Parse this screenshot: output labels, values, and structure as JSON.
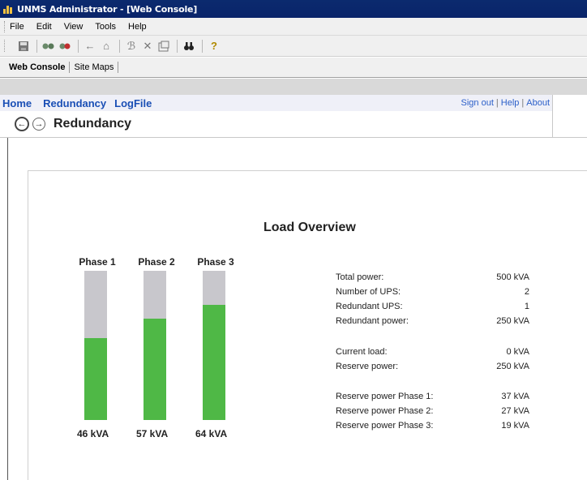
{
  "window": {
    "title": "UNMS Administrator - [Web Console]"
  },
  "menu": [
    "File",
    "Edit",
    "View",
    "Tools",
    "Help"
  ],
  "tabs": [
    {
      "label": "Web Console",
      "active": true
    },
    {
      "label": "Site Maps",
      "active": false
    }
  ],
  "nav": {
    "home": "Home",
    "redundancy": "Redundancy",
    "logfile": "LogFile",
    "sign_out": "Sign out",
    "help": "Help",
    "about": "About",
    "separator": "|"
  },
  "page": {
    "title": "Redundancy",
    "back_icon": "back-arrow-icon",
    "forward_icon": "forward-arrow-icon"
  },
  "load_overview": {
    "title": "Load Overview",
    "phases": [
      {
        "label": "Phase 1",
        "value": "46 kVA",
        "fill_fraction": 0.55
      },
      {
        "label": "Phase 2",
        "value": "57 kVA",
        "fill_fraction": 0.68
      },
      {
        "label": "Phase 3",
        "value": "64 kVA",
        "fill_fraction": 0.77
      }
    ],
    "stats": [
      {
        "label": "Total power:",
        "value": "500 kVA"
      },
      {
        "label": "Number of UPS:",
        "value": "2"
      },
      {
        "label": "Redundant UPS:",
        "value": "1"
      },
      {
        "label": "Redundant power:",
        "value": "250 kVA"
      },
      {
        "label": "Current load:",
        "value": "0 kVA"
      },
      {
        "label": "Reserve power:",
        "value": "250 kVA"
      },
      {
        "label": "Reserve power Phase 1:",
        "value": "37 kVA"
      },
      {
        "label": "Reserve power Phase 2:",
        "value": "27 kVA"
      },
      {
        "label": "Reserve power Phase 3:",
        "value": "19 kVA"
      }
    ]
  },
  "colors": {
    "bar_fill": "#4fb846",
    "bar_track": "#c8c7cc",
    "link": "#1a4fb5",
    "titlebar": "#0a246a"
  }
}
